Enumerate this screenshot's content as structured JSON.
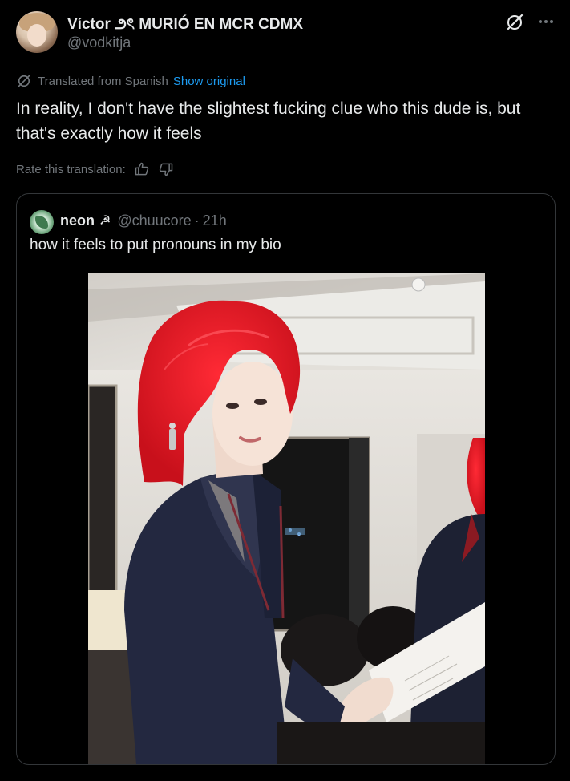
{
  "tweet": {
    "author": {
      "display_name": "Víctor ౨ৎ MURIÓ EN MCR CDMX",
      "handle": "@vodkitja"
    },
    "translation": {
      "label": "Translated from Spanish",
      "show_original": "Show original"
    },
    "text": "In reality, I don't have the slightest fucking clue who this dude is, but that's exactly how it feels",
    "rate_label": "Rate this translation:",
    "icons": {
      "grok": "grok-icon",
      "more": "more-icon",
      "translate": "translate-icon",
      "thumbs_up": "thumbs-up-icon",
      "thumbs_down": "thumbs-down-icon"
    }
  },
  "quote": {
    "name": "neon",
    "name_emoji": "☭",
    "handle": "@chuucore",
    "separator": "·",
    "time": "21h",
    "text": "how it feels to put pronouns in my bio"
  },
  "colors": {
    "background": "#000000",
    "text": "#e7e9ea",
    "muted": "#71767b",
    "link": "#1d9bf0",
    "border": "#333639",
    "hair": "#e8141f"
  }
}
